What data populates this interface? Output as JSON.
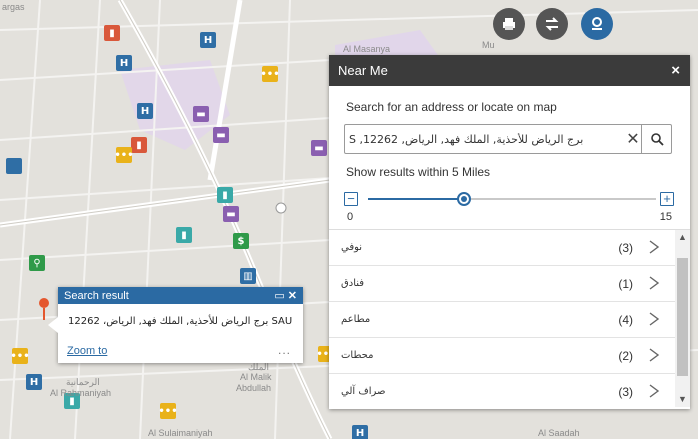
{
  "map": {
    "labels": {
      "corner": "argas",
      "asanya": "Al Masanya",
      "mu": "Mu",
      "rahmaniyah_ar": "الرحمانية",
      "rahmaniyah": "Al Rahmaniyah",
      "malik_ar": "الملك",
      "malik": "Al Malik",
      "abdullah": "Abdullah",
      "sulaimaniyah": "Al Sulaimaniyah",
      "saadah": "Al Saadah"
    },
    "poi_glyphs": {
      "hotel": "H",
      "fuel": "⛽",
      "food": "🍴",
      "bed": "▬"
    }
  },
  "toolbar": {
    "print_icon": "printer-icon",
    "swap_icon": "swap-icon",
    "locate_icon": "location-icon"
  },
  "near_me": {
    "title": "Near Me",
    "close": "×",
    "prompt": "Search for an address or locate on map",
    "search_value": "برج الرياض للأحذية, الملك فهد, الرياض, 12262, S",
    "radius_label": "Show results within 5 Miles",
    "slider": {
      "min": "0",
      "max": "15",
      "value": 5,
      "minus": "−",
      "plus": "+"
    },
    "results": [
      {
        "name": "نوفي",
        "count": "(3)"
      },
      {
        "name": "فنادق",
        "count": "(1)"
      },
      {
        "name": "مطاعم",
        "count": "(4)"
      },
      {
        "name": "محطات",
        "count": "(2)"
      },
      {
        "name": "صراف آلي",
        "count": "(3)"
      }
    ]
  },
  "popup": {
    "title": "Search result",
    "body": "برج الرياض للأحذية, الملك فهد, الرياض، 12262 SAU",
    "zoom_label": "Zoom to",
    "more": "..."
  },
  "colors": {
    "accent": "#2b6aa3",
    "header_dark": "#3b3b3b"
  }
}
